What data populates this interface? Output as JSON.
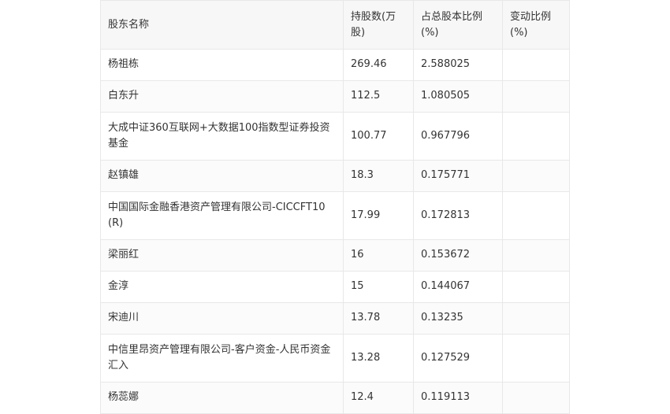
{
  "table": {
    "headers": [
      "股东名称",
      "持股数(万股)",
      "占总股本比例(%)",
      "变动比例(%)"
    ],
    "rows": [
      {
        "name": "杨祖栋",
        "shares": "269.46",
        "ratio": "2.588025",
        "change": ""
      },
      {
        "name": "白东升",
        "shares": "112.5",
        "ratio": "1.080505",
        "change": ""
      },
      {
        "name": "大成中证360互联网+大数据100指数型证券投资基金",
        "shares": "100.77",
        "ratio": "0.967796",
        "change": ""
      },
      {
        "name": "赵镇雄",
        "shares": "18.3",
        "ratio": "0.175771",
        "change": ""
      },
      {
        "name": "中国国际金融香港资产管理有限公司-CICCFT10(R)",
        "shares": "17.99",
        "ratio": "0.172813",
        "change": ""
      },
      {
        "name": "梁丽红",
        "shares": "16",
        "ratio": "0.153672",
        "change": ""
      },
      {
        "name": "金淳",
        "shares": "15",
        "ratio": "0.144067",
        "change": ""
      },
      {
        "name": "宋迪川",
        "shares": "13.78",
        "ratio": "0.13235",
        "change": ""
      },
      {
        "name": "中信里昂资产管理有限公司-客户资金-人民币资金汇入",
        "shares": "13.28",
        "ratio": "0.127529",
        "change": ""
      },
      {
        "name": "杨蕊娜",
        "shares": "12.4",
        "ratio": "0.119113",
        "change": ""
      }
    ]
  }
}
